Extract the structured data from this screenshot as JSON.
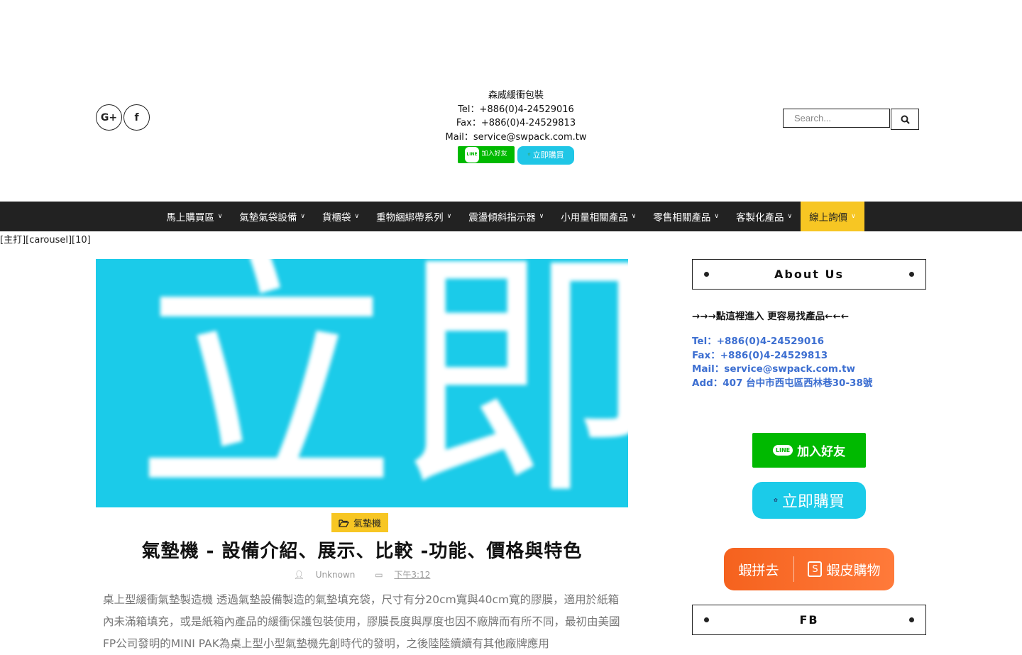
{
  "header": {
    "social": [
      {
        "icon": "google-plus-icon",
        "glyph": "G+"
      },
      {
        "icon": "facebook-icon",
        "glyph": "f"
      }
    ],
    "contact": {
      "name": "森威緩衝包裝",
      "tel": "Tel：+886(0)4-24529016",
      "fax": "Fax：+886(0)4-24529813",
      "mail": "Mail：service@swpack.com.tw",
      "line_button": "加入好友",
      "line_bubble": "LINE",
      "buy_button": "立即購買"
    },
    "search": {
      "placeholder": "Search..."
    }
  },
  "nav": {
    "items": [
      {
        "label": "馬上購買區"
      },
      {
        "label": "氣墊氣袋設備"
      },
      {
        "label": "貨櫃袋"
      },
      {
        "label": "重物綑綁帶系列"
      },
      {
        "label": "震盪傾斜指示器"
      },
      {
        "label": "小用量相關產品"
      },
      {
        "label": "零售相關產品"
      },
      {
        "label": "客製化產品"
      },
      {
        "label": "線上詢價"
      }
    ]
  },
  "shortcode": "[主打][carousel][10]",
  "post": {
    "feature_text": "立即購",
    "category": "氣墊機",
    "title": "氣墊機 - 設備介紹、展示、比較 -功能、價格與特色",
    "author": "Unknown",
    "date": "下午3:12",
    "excerpt": "桌上型緩衝氣墊製造機 透過氣墊設備製造的氣墊填充袋，尺寸有分20cm寬與40cm寬的膠膜，適用於紙箱內未滿箱填充，或是紙箱內產品的緩衝保護包裝使用，膠膜長度與厚度也因不廠牌而有所不同，最初由美國FP公司發明的MINI PAK為桌上型小型氣墊機先創時代的發明，之後陸陸續續有其他廠牌應用"
  },
  "sidebar": {
    "about_title": "About Us",
    "about_link": "→→→點這裡進入 更容易找產品←←←",
    "tel": "Tel：+886(0)4-24529016",
    "fax": "Fax：+886(0)4-24529813",
    "mail": "Mail：service@swpack.com.tw",
    "addr": "Add：407 台中市西屯區西林巷30-38號",
    "line_button": "加入好友",
    "line_bubble": "LINE",
    "buy_button": "立即購買",
    "shopee_left": "蝦拼去",
    "shopee_right": "蝦皮購物",
    "fb_title": "FB"
  },
  "colors": {
    "nav_bg": "#222222",
    "accent": "#f7c623",
    "line_green": "#00b900",
    "cyan": "#1bcbe9",
    "link_blue": "#3d6fd1",
    "shopee": "#f5621e"
  }
}
